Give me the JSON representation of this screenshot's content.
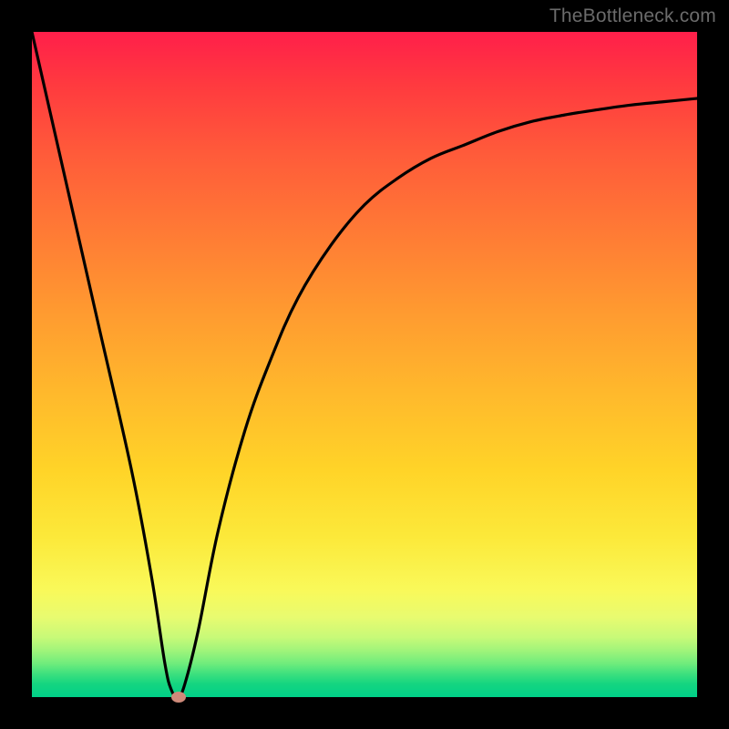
{
  "watermark": "TheBottleneck.com",
  "chart_data": {
    "type": "line",
    "title": "",
    "xlabel": "",
    "ylabel": "",
    "xlim": [
      0,
      100
    ],
    "ylim": [
      0,
      100
    ],
    "grid": false,
    "series": [
      {
        "name": "bottleneck-curve",
        "x": [
          0,
          5,
          10,
          15,
          18,
          20,
          21,
          22,
          23,
          25,
          28,
          32,
          36,
          40,
          45,
          50,
          55,
          60,
          65,
          70,
          75,
          80,
          85,
          90,
          95,
          100
        ],
        "values": [
          100,
          78,
          56,
          34,
          18,
          5,
          1,
          0,
          2,
          10,
          25,
          40,
          51,
          60,
          68,
          74,
          78,
          81,
          83,
          85,
          86.5,
          87.5,
          88.3,
          89,
          89.5,
          90
        ]
      }
    ],
    "marker": {
      "x": 22,
      "y": 0,
      "color": "#cf8a7a"
    },
    "background_gradient": {
      "top": "#ff1f4a",
      "upper_mid": "#ff9a30",
      "lower_mid": "#f9f95a",
      "bottom": "#00d088"
    }
  }
}
